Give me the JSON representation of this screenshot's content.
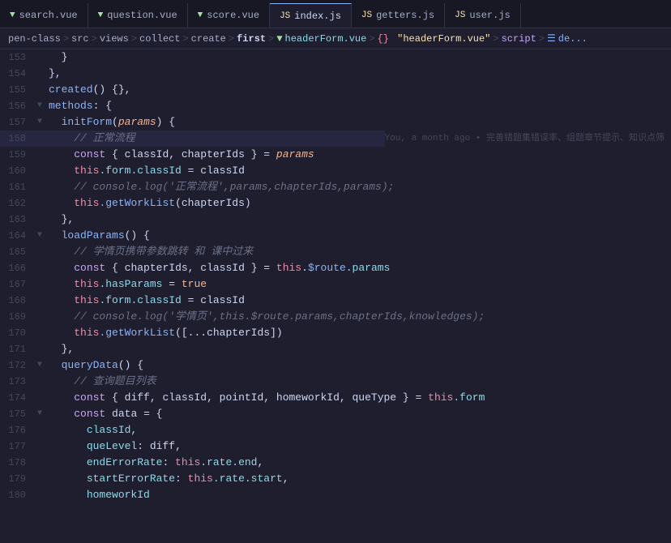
{
  "tabs": [
    {
      "id": "search-vue",
      "label": "search.vue",
      "type": "vue",
      "active": false
    },
    {
      "id": "question-vue",
      "label": "question.vue",
      "type": "vue",
      "active": false
    },
    {
      "id": "score-vue",
      "label": "score.vue",
      "type": "vue",
      "active": false
    },
    {
      "id": "index-js",
      "label": "index.js",
      "type": "js",
      "active": true
    },
    {
      "id": "getters-js",
      "label": "getters.js",
      "type": "js",
      "active": false
    },
    {
      "id": "user-js",
      "label": "user.js",
      "type": "js",
      "active": false
    }
  ],
  "breadcrumb": {
    "parts": [
      {
        "text": "pen-class",
        "class": "bc-item"
      },
      {
        "text": ">",
        "class": "bc-sep"
      },
      {
        "text": "src",
        "class": "bc-item"
      },
      {
        "text": ">",
        "class": "bc-sep"
      },
      {
        "text": "views",
        "class": "bc-item"
      },
      {
        "text": ">",
        "class": "bc-sep"
      },
      {
        "text": "collect",
        "class": "bc-item"
      },
      {
        "text": ">",
        "class": "bc-sep"
      },
      {
        "text": "create",
        "class": "bc-item"
      },
      {
        "text": ">",
        "class": "bc-sep"
      },
      {
        "text": "first",
        "class": "bc-first"
      },
      {
        "text": ">",
        "class": "bc-sep"
      },
      {
        "text": "▼",
        "class": "bc-arrow"
      },
      {
        "text": "headerForm.vue",
        "class": "bc-file"
      },
      {
        "text": ">",
        "class": "bc-sep"
      },
      {
        "text": "{}",
        "class": "bc-braces"
      },
      {
        "text": "\"headerForm.vue\"",
        "class": "bc-string"
      },
      {
        "text": ">",
        "class": "bc-sep"
      },
      {
        "text": "script",
        "class": "bc-script"
      },
      {
        "text": ">",
        "class": "bc-sep"
      },
      {
        "text": "☰",
        "class": "bc-item"
      },
      {
        "text": "de...",
        "class": "bc-item"
      }
    ]
  },
  "blame_text": "You, a month ago • 完善错题集错误率、组题章节提示、知识点筛",
  "lines": [
    {
      "num": "153",
      "fold": "",
      "content": [
        {
          "text": "  }",
          "class": "punct"
        }
      ]
    },
    {
      "num": "154",
      "fold": "",
      "content": [
        {
          "text": "},",
          "class": "punct"
        }
      ]
    },
    {
      "num": "155",
      "fold": "",
      "content": [
        {
          "text": "created() {},",
          "class": "fn"
        }
      ]
    },
    {
      "num": "156",
      "fold": "▼",
      "content": [
        {
          "text": "methods: {",
          "class": "obj"
        }
      ]
    },
    {
      "num": "157",
      "fold": "▼",
      "content": [
        {
          "text": "  initForm(",
          "class": "fn"
        },
        {
          "text": "params",
          "class": "param"
        },
        {
          "text": ") {",
          "class": "punct"
        }
      ]
    },
    {
      "num": "158",
      "fold": "",
      "content": [
        {
          "text": "    // ",
          "class": "cm"
        },
        {
          "text": "正常流程",
          "class": "cm-cn"
        }
      ],
      "blame": true
    },
    {
      "num": "159",
      "fold": "",
      "content": [
        {
          "text": "    ",
          "class": ""
        },
        {
          "text": "const",
          "class": "kw"
        },
        {
          "text": " { classId, chapterIds } = ",
          "class": "var-name"
        },
        {
          "text": "params",
          "class": "param"
        }
      ]
    },
    {
      "num": "160",
      "fold": "",
      "content": [
        {
          "text": "    ",
          "class": ""
        },
        {
          "text": "this",
          "class": "this-kw"
        },
        {
          "text": ".form.classId = classId",
          "class": "prop"
        }
      ]
    },
    {
      "num": "161",
      "fold": "",
      "content": [
        {
          "text": "    // console.log('",
          "class": "cm"
        },
        {
          "text": "正常流程",
          "class": "cm-cn"
        },
        {
          "text": "',params,chapterIds,params);",
          "class": "cm"
        }
      ]
    },
    {
      "num": "162",
      "fold": "",
      "content": [
        {
          "text": "    ",
          "class": ""
        },
        {
          "text": "this",
          "class": "this-kw"
        },
        {
          "text": ".getWorkList(chapterIds)",
          "class": "fn"
        }
      ]
    },
    {
      "num": "163",
      "fold": "",
      "content": [
        {
          "text": "  },",
          "class": "punct"
        }
      ]
    },
    {
      "num": "164",
      "fold": "▼",
      "content": [
        {
          "text": "  loadParams() {",
          "class": "fn"
        }
      ]
    },
    {
      "num": "165",
      "fold": "",
      "content": [
        {
          "text": "    // ",
          "class": "cm"
        },
        {
          "text": "学情页携带参数跳转 和 课中过来",
          "class": "cm-cn"
        }
      ]
    },
    {
      "num": "166",
      "fold": "",
      "content": [
        {
          "text": "    ",
          "class": ""
        },
        {
          "text": "const",
          "class": "kw"
        },
        {
          "text": " { chapterIds, classId } = ",
          "class": "var-name"
        },
        {
          "text": "this",
          "class": "this-kw"
        },
        {
          "text": ".",
          "class": "punct"
        },
        {
          "text": "$route",
          "class": "route"
        },
        {
          "text": ".params",
          "class": "prop"
        }
      ]
    },
    {
      "num": "167",
      "fold": "",
      "content": [
        {
          "text": "    ",
          "class": ""
        },
        {
          "text": "this",
          "class": "this-kw"
        },
        {
          "text": ".hasParams = ",
          "class": "prop"
        },
        {
          "text": "true",
          "class": "true-kw"
        }
      ]
    },
    {
      "num": "168",
      "fold": "",
      "content": [
        {
          "text": "    ",
          "class": ""
        },
        {
          "text": "this",
          "class": "this-kw"
        },
        {
          "text": ".form.classId = classId",
          "class": "prop"
        }
      ]
    },
    {
      "num": "169",
      "fold": "",
      "content": [
        {
          "text": "    // console.log('",
          "class": "cm"
        },
        {
          "text": "学情页",
          "class": "cm-cn"
        },
        {
          "text": "',this.$route.params,chapterIds,knowledges);",
          "class": "cm"
        }
      ]
    },
    {
      "num": "170",
      "fold": "",
      "content": [
        {
          "text": "    ",
          "class": ""
        },
        {
          "text": "this",
          "class": "this-kw"
        },
        {
          "text": ".getWorkList([...",
          "class": "fn"
        },
        {
          "text": "chapterIds",
          "class": "param"
        },
        {
          "text": "])",
          "class": "punct"
        }
      ]
    },
    {
      "num": "171",
      "fold": "",
      "content": [
        {
          "text": "  },",
          "class": "punct"
        }
      ]
    },
    {
      "num": "172",
      "fold": "▼",
      "content": [
        {
          "text": "  queryData() {",
          "class": "fn"
        }
      ]
    },
    {
      "num": "173",
      "fold": "",
      "content": [
        {
          "text": "    // ",
          "class": "cm"
        },
        {
          "text": "查询题目列表",
          "class": "cm-cn"
        }
      ]
    },
    {
      "num": "174",
      "fold": "",
      "content": [
        {
          "text": "    ",
          "class": ""
        },
        {
          "text": "const",
          "class": "kw"
        },
        {
          "text": " { diff, classId, pointId, homeworkId, queType } = ",
          "class": "var-name"
        },
        {
          "text": "this",
          "class": "this-kw"
        },
        {
          "text": ".form",
          "class": "prop"
        }
      ]
    },
    {
      "num": "175",
      "fold": "▼",
      "content": [
        {
          "text": "    ",
          "class": ""
        },
        {
          "text": "const",
          "class": "kw"
        },
        {
          "text": " data = {",
          "class": "var-name"
        }
      ]
    },
    {
      "num": "176",
      "fold": "",
      "content": [
        {
          "text": "      classId,",
          "class": "prop"
        }
      ]
    },
    {
      "num": "177",
      "fold": "",
      "content": [
        {
          "text": "      queLevel: diff,",
          "class": "prop"
        }
      ]
    },
    {
      "num": "178",
      "fold": "",
      "content": [
        {
          "text": "      endErrorRate: ",
          "class": "prop"
        },
        {
          "text": "this",
          "class": "this-kw"
        },
        {
          "text": ".rate.end,",
          "class": "prop"
        }
      ]
    },
    {
      "num": "179",
      "fold": "",
      "content": [
        {
          "text": "      startErrorRate: ",
          "class": "prop"
        },
        {
          "text": "this",
          "class": "this-kw"
        },
        {
          "text": ".rate.start,",
          "class": "prop"
        }
      ]
    },
    {
      "num": "180",
      "fold": "",
      "content": [
        {
          "text": "      homeworkId",
          "class": "prop"
        }
      ]
    }
  ]
}
